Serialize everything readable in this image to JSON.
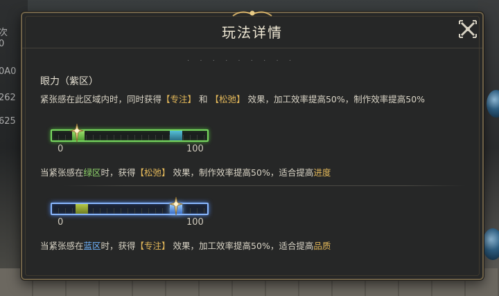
{
  "background": {
    "left_numbers": [
      "次",
      "0",
      "0A0",
      "262",
      "625"
    ]
  },
  "dialog": {
    "title": "玩法详情",
    "close_icon": "close-icon",
    "section_title": "眼力（紫区）",
    "description": {
      "p1": "紧张感在此区域内时，同时获得",
      "focus": "【专注】",
      "p2": " 和 ",
      "relax": "【松弛】",
      "p3": " 效果，加工效率提高50%，制作效率提高50%"
    },
    "bars": [
      {
        "style": "green",
        "min_label": "0",
        "max_label": "100",
        "marker_value": 16,
        "zones": [
          {
            "kind": "green",
            "from": 13,
            "to": 21
          },
          {
            "kind": "teal",
            "from": 76,
            "to": 84
          }
        ],
        "caption": {
          "p1": "当紧张感在",
          "zone": "绿区",
          "p2": "时，获得",
          "effect": "【松弛】",
          "p3": " 效果，制作效率提高50%，适合提高",
          "goal": "进度"
        }
      },
      {
        "style": "blue",
        "min_label": "0",
        "max_label": "100",
        "marker_value": 80,
        "zones": [
          {
            "kind": "olive",
            "from": 15,
            "to": 23
          },
          {
            "kind": "blue",
            "from": 76,
            "to": 84
          }
        ],
        "caption": {
          "p1": "当紧张感在",
          "zone": "蓝区",
          "p2": "时，获得",
          "effect": "【专注】",
          "p3": " 效果，加工效率提高50%，适合提高",
          "goal": "品质"
        }
      }
    ]
  },
  "colors": {
    "dialog_bg": "#262727",
    "frame_gold": "#6e6147",
    "highlight_gold": "#e3b85a",
    "green_zone": "#8fd36b",
    "blue_zone": "#6fb4ff"
  }
}
